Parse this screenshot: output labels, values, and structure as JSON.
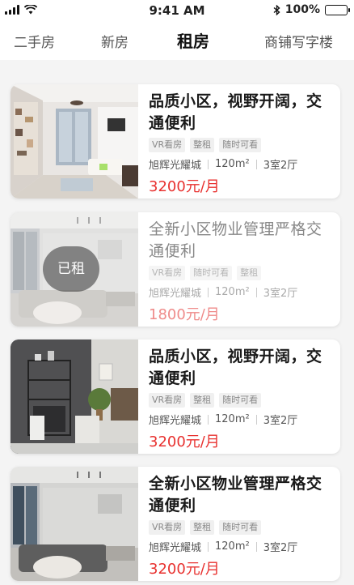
{
  "status_bar": {
    "time": "9:41 AM",
    "battery": "100%"
  },
  "tabs": [
    {
      "label": "二手房",
      "active": false
    },
    {
      "label": "新房",
      "active": false
    },
    {
      "label": "租房",
      "active": true
    },
    {
      "label": "商铺写字楼",
      "active": false
    }
  ],
  "listings": [
    {
      "title": "品质小区，视野开阔，交通便利",
      "tags": [
        "VR看房",
        "整租",
        "随时可看"
      ],
      "community": "旭辉光耀城",
      "area": "120m²",
      "layout": "3室2厅",
      "price": "3200元/月",
      "rented": false
    },
    {
      "title": "全新小区物业管理严格交通便利",
      "tags": [
        "VR看房",
        "随时可看",
        "整租"
      ],
      "community": "旭辉光耀城",
      "area": "120m²",
      "layout": "3室2厅",
      "price": "1800元/月",
      "rented": true,
      "rented_label": "已租"
    },
    {
      "title": "品质小区，视野开阔，交通便利",
      "tags": [
        "VR看房",
        "整租",
        "随时可看"
      ],
      "community": "旭辉光耀城",
      "area": "120m²",
      "layout": "3室2厅",
      "price": "3200元/月",
      "rented": false
    },
    {
      "title": "全新小区物业管理严格交通便利",
      "tags": [
        "VR看房",
        "整租",
        "随时可看"
      ],
      "community": "旭辉光耀城",
      "area": "120m²",
      "layout": "3室2厅",
      "price": "3200元/月",
      "rented": false
    }
  ],
  "colors": {
    "price": "#e8312f",
    "accent_text": "#111111"
  }
}
